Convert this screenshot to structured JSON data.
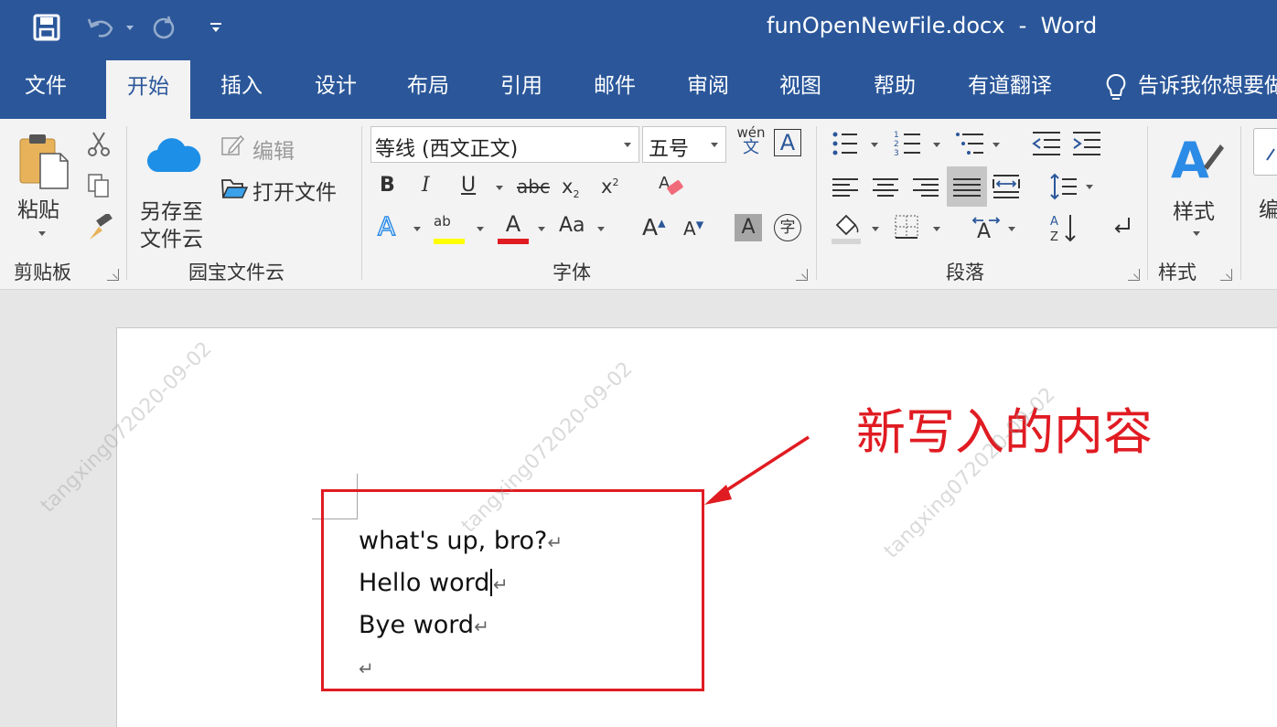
{
  "titlebar": {
    "title": "funOpenNewFile.docx  -  Word"
  },
  "tabs": [
    "文件",
    "开始",
    "插入",
    "设计",
    "布局",
    "引用",
    "邮件",
    "审阅",
    "视图",
    "帮助",
    "有道翻译"
  ],
  "tellme": "告诉我你想要做",
  "clipboard": {
    "paste_label": "粘贴",
    "group_label": "剪贴板"
  },
  "cloud": {
    "save_label_line1": "另存至",
    "save_label_line2": "文件云",
    "edit_label": "编辑",
    "open_label": "打开文件",
    "group_label": "园宝文件云"
  },
  "font": {
    "font_name": "等线 (西文正文)",
    "font_size": "五号",
    "group_label": "字体",
    "phonetic_top": "wén",
    "phonetic_bottom": "文"
  },
  "paragraph": {
    "group_label": "段落"
  },
  "styles": {
    "label": "样式",
    "group_label": "样式"
  },
  "editing": {
    "label": "编"
  },
  "document": {
    "lines": [
      "what's up, bro?",
      "Hello word",
      "Bye word",
      ""
    ]
  },
  "annotation": "新写入的内容",
  "watermark": "tangxing072020-09-02",
  "colors": {
    "brand": "#2b579a",
    "annotation_red": "#e01b22",
    "highlight_yellow": "#ffff00",
    "font_red": "#e01b22"
  }
}
